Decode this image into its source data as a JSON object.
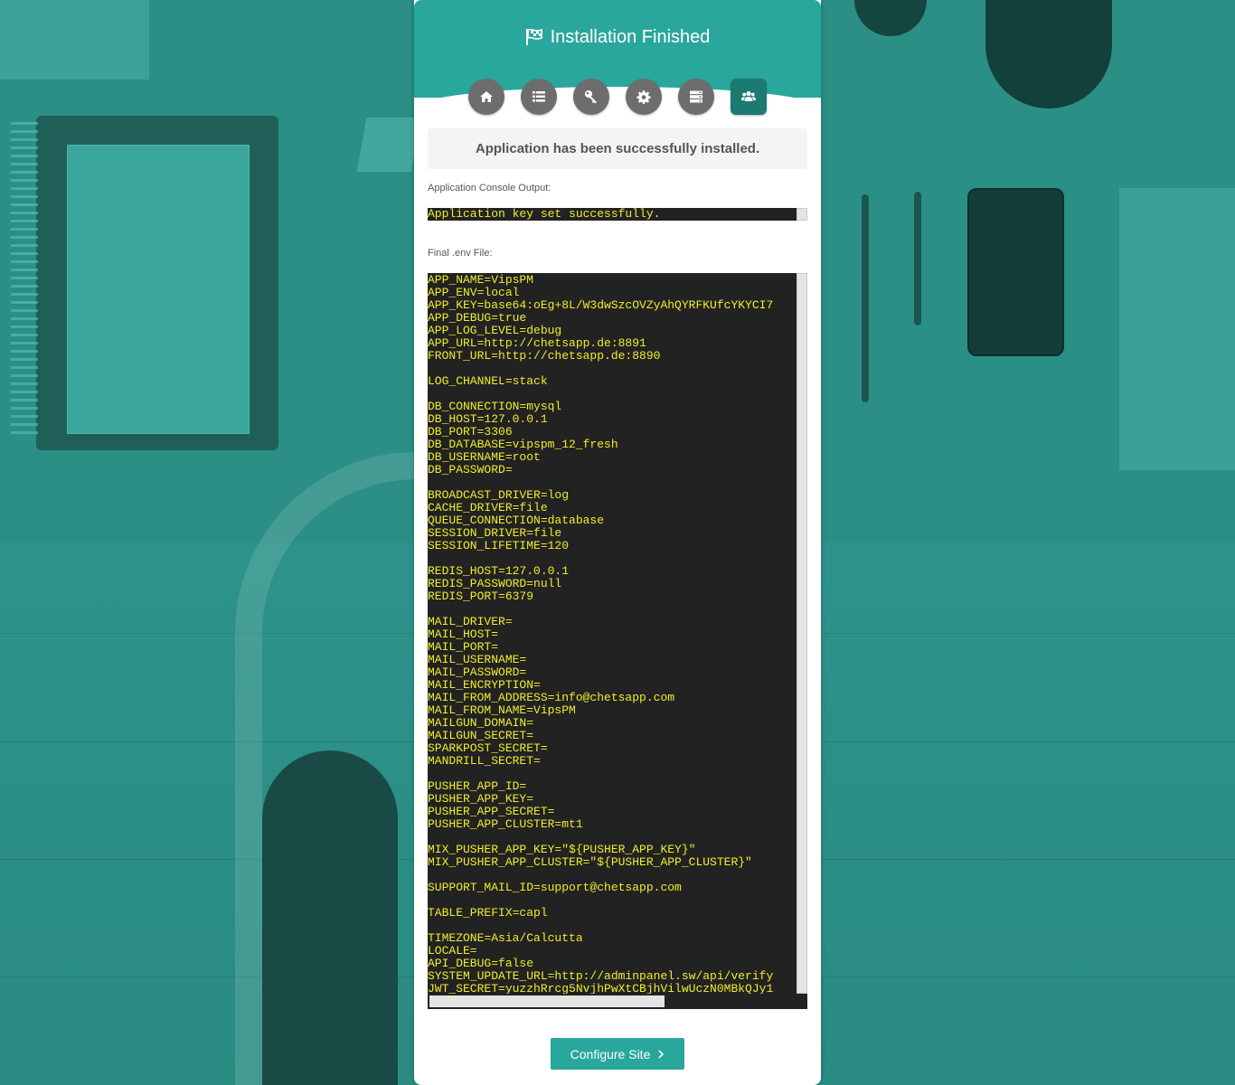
{
  "header": {
    "title": "Installation Finished",
    "title_icon": "flag-checkered-icon",
    "accent": "#2aa79c"
  },
  "steps": [
    {
      "name": "welcome",
      "icon": "home-icon",
      "active": false
    },
    {
      "name": "requirements",
      "icon": "list-icon",
      "active": false
    },
    {
      "name": "permissions",
      "icon": "key-icon",
      "active": false
    },
    {
      "name": "settings",
      "icon": "gear-icon",
      "active": false
    },
    {
      "name": "database",
      "icon": "server-icon",
      "active": false
    },
    {
      "name": "final",
      "icon": "users-icon",
      "active": true
    }
  ],
  "alert": {
    "message": "Application has been successfully installed."
  },
  "console": {
    "label": "Application Console Output:",
    "output": "Application key set successfully."
  },
  "env": {
    "label": "Final .env File:",
    "content": "APP_NAME=VipsPM\nAPP_ENV=local\nAPP_KEY=base64:oEg+8L/W3dwSzcOVZyAhQYRFKUfcYKYCI7\nAPP_DEBUG=true\nAPP_LOG_LEVEL=debug\nAPP_URL=http://chetsapp.de:8891\nFRONT_URL=http://chetsapp.de:8890\n\nLOG_CHANNEL=stack\n\nDB_CONNECTION=mysql\nDB_HOST=127.0.0.1\nDB_PORT=3306\nDB_DATABASE=vipspm_12_fresh\nDB_USERNAME=root\nDB_PASSWORD=\n\nBROADCAST_DRIVER=log\nCACHE_DRIVER=file\nQUEUE_CONNECTION=database\nSESSION_DRIVER=file\nSESSION_LIFETIME=120\n\nREDIS_HOST=127.0.0.1\nREDIS_PASSWORD=null\nREDIS_PORT=6379\n\nMAIL_DRIVER=\nMAIL_HOST=\nMAIL_PORT=\nMAIL_USERNAME=\nMAIL_PASSWORD=\nMAIL_ENCRYPTION=\nMAIL_FROM_ADDRESS=info@chetsapp.com\nMAIL_FROM_NAME=VipsPM\nMAILGUN_DOMAIN=\nMAILGUN_SECRET=\nSPARKPOST_SECRET=\nMANDRILL_SECRET=\n\nPUSHER_APP_ID=\nPUSHER_APP_KEY=\nPUSHER_APP_SECRET=\nPUSHER_APP_CLUSTER=mt1\n\nMIX_PUSHER_APP_KEY=\"${PUSHER_APP_KEY}\"\nMIX_PUSHER_APP_CLUSTER=\"${PUSHER_APP_CLUSTER}\"\n\nSUPPORT_MAIL_ID=support@chetsapp.com\n\nTABLE_PREFIX=capl\n\nTIMEZONE=Asia/Calcutta\nLOCALE=\nAPI_DEBUG=false\nSYSTEM_UPDATE_URL=http://adminpanel.sw/api/verify\nJWT_SECRET=yuzzhRrcg5NvjhPwXtCBjhVilwUczN0MBkQJy1"
  },
  "actions": {
    "configure_label": "Configure Site",
    "configure_icon": "chevron-right-icon"
  }
}
